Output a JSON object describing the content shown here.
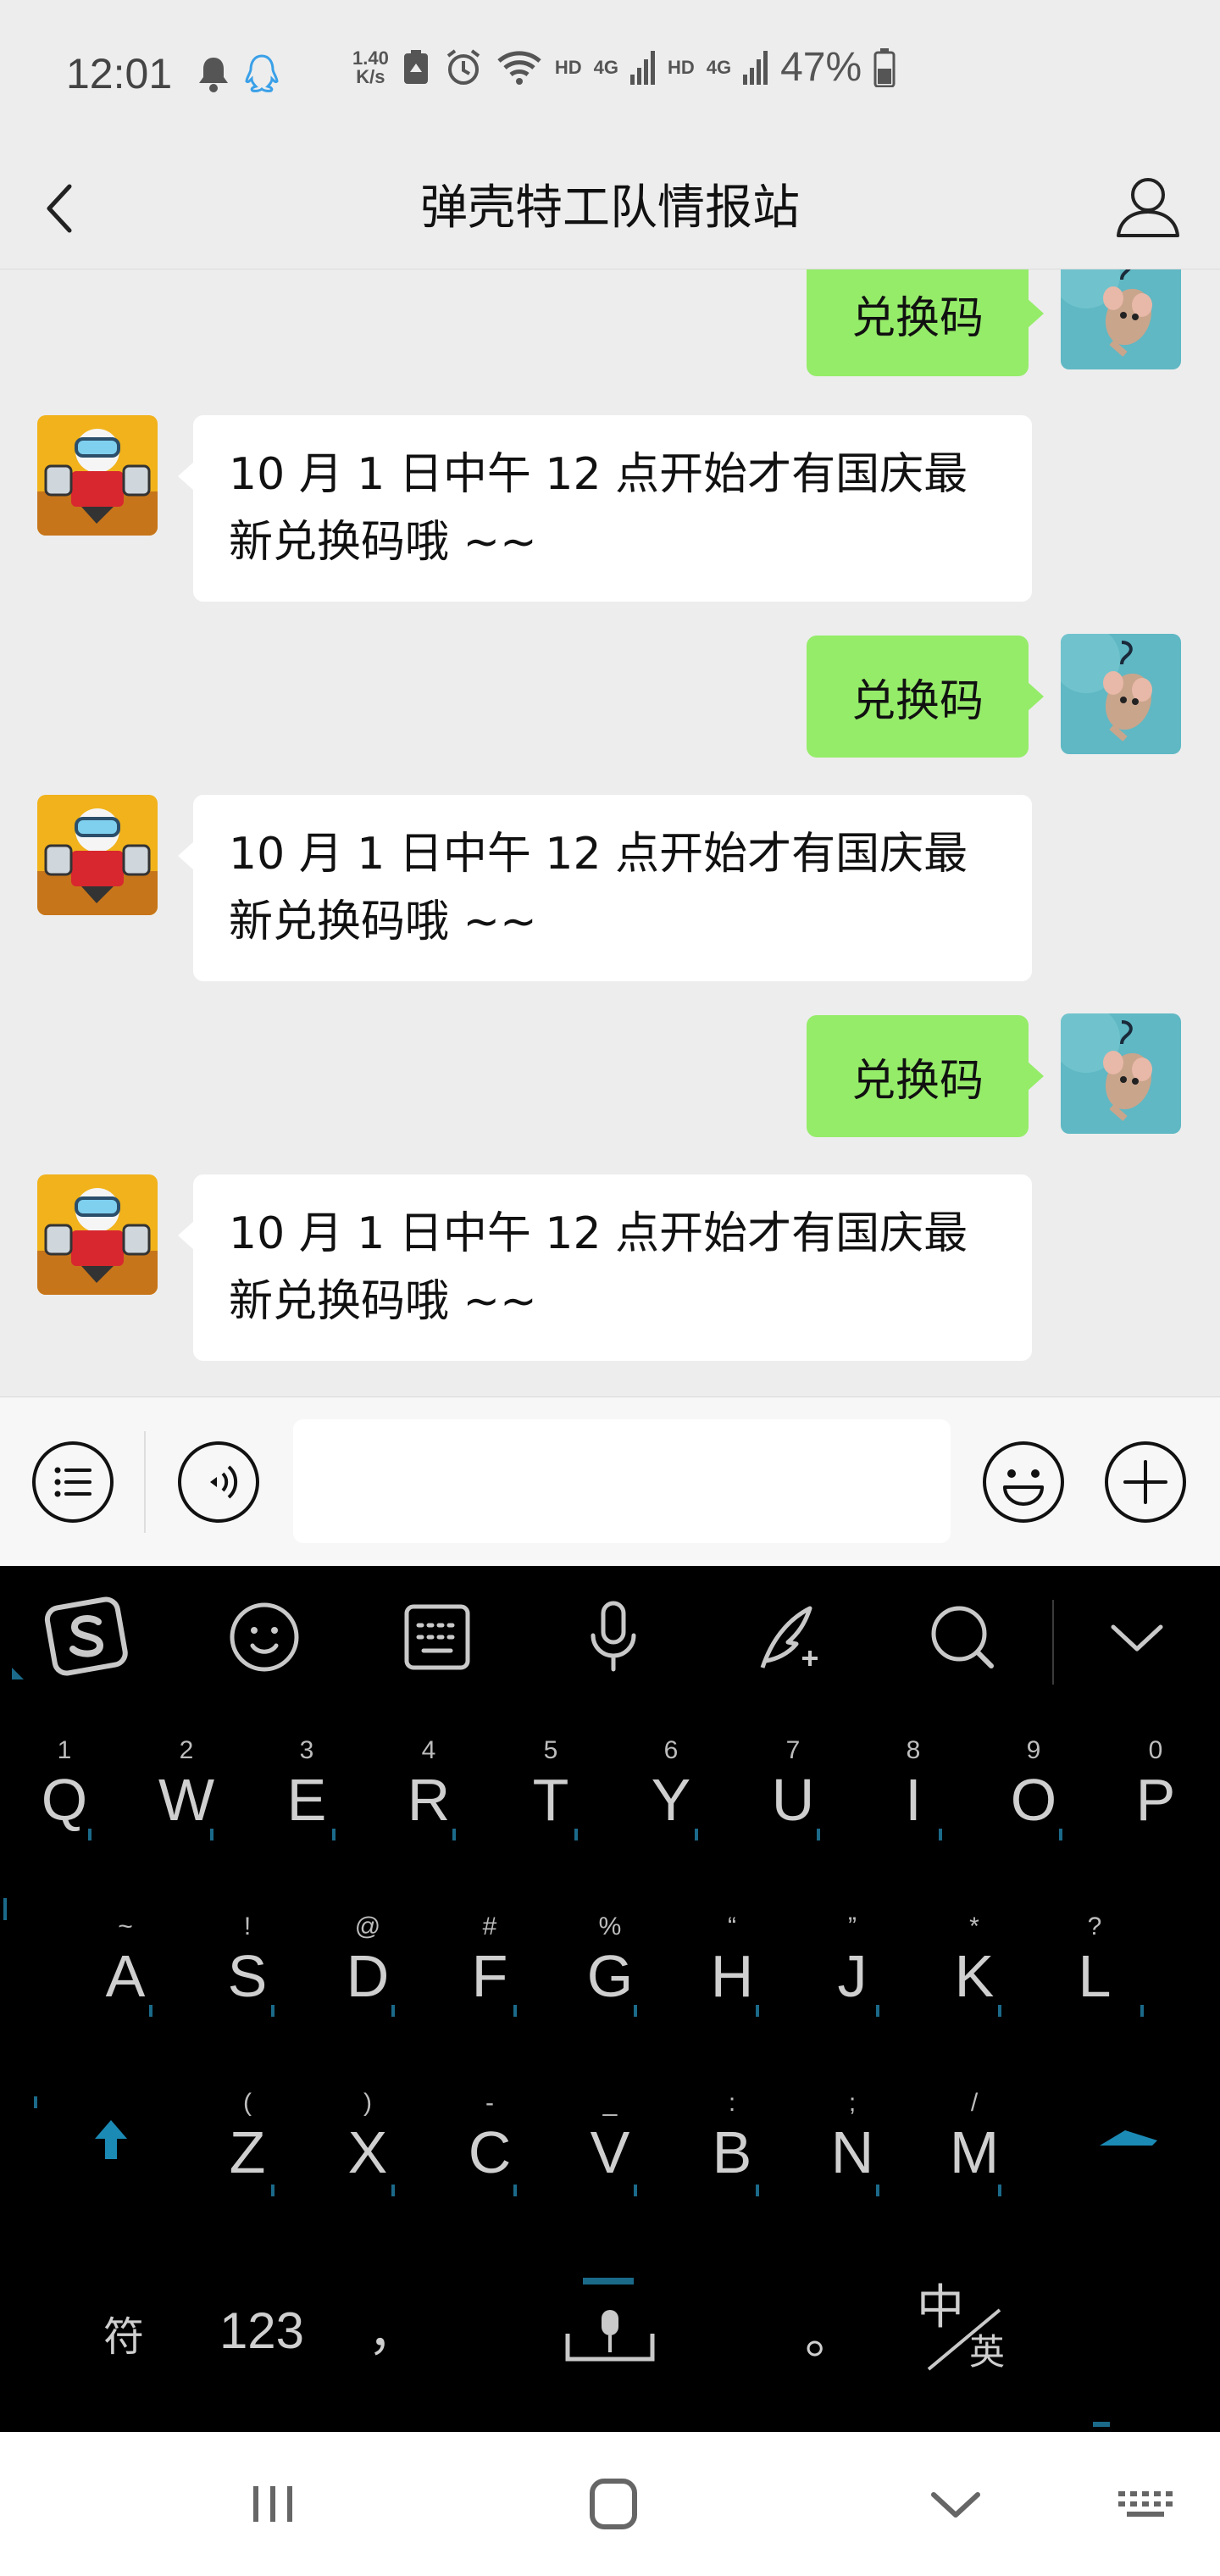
{
  "status_bar": {
    "time": "12:01",
    "speed_value": "1.40",
    "speed_unit": "K/s",
    "hd1": "HD",
    "net1": "4G",
    "hd2": "HD",
    "net2": "4G",
    "battery": "47%"
  },
  "header": {
    "title": "弹壳特工队情报站",
    "back_icon": "chevron-left-icon",
    "profile_icon": "user-icon"
  },
  "messages": [
    {
      "side": "right",
      "text": "兑换码"
    },
    {
      "side": "left",
      "line1": "10 月 1 日中午 12 点开始才有国庆最",
      "line2": "新兑换码哦 ~~"
    },
    {
      "side": "right",
      "text": "兑换码"
    },
    {
      "side": "left",
      "line1": "10 月 1 日中午 12 点开始才有国庆最",
      "line2": "新兑换码哦 ~~"
    },
    {
      "side": "right",
      "text": "兑换码"
    },
    {
      "side": "left",
      "line1": "10 月 1 日中午 12 点开始才有国庆最",
      "line2": "新兑换码哦 ~~"
    }
  ],
  "input_bar": {
    "menu_icon": "list-icon",
    "voice_icon": "voice-icon",
    "emoji_icon": "smiley-icon",
    "plus_icon": "plus-icon",
    "input_value": ""
  },
  "keyboard": {
    "row1": [
      {
        "sub": "1",
        "main": "Q"
      },
      {
        "sub": "2",
        "main": "W"
      },
      {
        "sub": "3",
        "main": "E"
      },
      {
        "sub": "4",
        "main": "R"
      },
      {
        "sub": "5",
        "main": "T"
      },
      {
        "sub": "6",
        "main": "Y"
      },
      {
        "sub": "7",
        "main": "U"
      },
      {
        "sub": "8",
        "main": "I"
      },
      {
        "sub": "9",
        "main": "O"
      },
      {
        "sub": "0",
        "main": "P"
      }
    ],
    "row2": [
      {
        "sub": "~",
        "main": "A"
      },
      {
        "sub": "!",
        "main": "S"
      },
      {
        "sub": "@",
        "main": "D"
      },
      {
        "sub": "#",
        "main": "F"
      },
      {
        "sub": "%",
        "main": "G"
      },
      {
        "sub": "“",
        "main": "H"
      },
      {
        "sub": "”",
        "main": "J"
      },
      {
        "sub": "*",
        "main": "K"
      },
      {
        "sub": "?",
        "main": "L"
      }
    ],
    "row3": [
      {
        "sub": "(",
        "main": "Z"
      },
      {
        "sub": ")",
        "main": "X"
      },
      {
        "sub": "-",
        "main": "C"
      },
      {
        "sub": "_",
        "main": "V"
      },
      {
        "sub": ":",
        "main": "B"
      },
      {
        "sub": ";",
        "main": "N"
      },
      {
        "sub": "/",
        "main": "M"
      }
    ],
    "bottom": {
      "symbols": "符",
      "numbers": "123",
      "comma": "，",
      "period": "。",
      "lang_zh": "中",
      "lang_en": "英"
    },
    "accent_color": "#1b6a8a"
  },
  "nav": {
    "recents_icon": "recents-icon",
    "home_icon": "home-icon",
    "back_icon": "chevron-down-icon",
    "keyboard_icon": "keyboard-icon"
  }
}
